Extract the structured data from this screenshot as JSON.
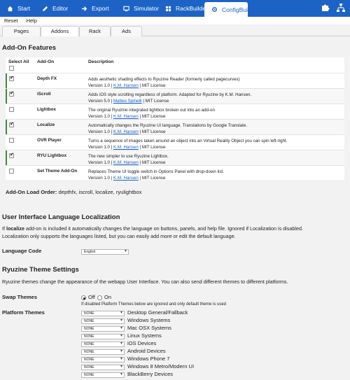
{
  "topbar": {
    "tabs": [
      {
        "label": "Start",
        "icon": "home-icon"
      },
      {
        "label": "Editor",
        "icon": "pencil-icon"
      },
      {
        "label": "Export",
        "icon": "export-icon"
      },
      {
        "label": "Simulator",
        "icon": "monitor-icon"
      },
      {
        "label": "RackBuilder",
        "icon": "grid-icon"
      },
      {
        "label": "ConfigBuilder",
        "icon": "gear-icon",
        "active": true
      }
    ],
    "right_icons": [
      "puzzle-icon",
      "sitemap-icon"
    ]
  },
  "subbar": {
    "reset": "Reset",
    "help": "Help"
  },
  "page_tabs": [
    {
      "label": "Pages"
    },
    {
      "label": "Addons",
      "active": true
    },
    {
      "label": "Rack"
    },
    {
      "label": "Ads"
    }
  ],
  "addons": {
    "heading": "Add-On Features",
    "col_select_all": "Select All",
    "col_addon": "Add-On",
    "col_description": "Description",
    "rows": [
      {
        "checked": true,
        "name": "Depth FX",
        "desc": "Adds aesthetic shading effects to Ryuzine Reader (formerly called pagecurves)",
        "version": "Version 1.0 |",
        "author": "K.M. Hansen",
        "license": "| MIT License"
      },
      {
        "checked": true,
        "name": "iScroll",
        "desc": "Adds iOS style scrolling regardless of platform. Adapted for Ryuzine by K.M. Hansen.",
        "version": "Version 5.0 |",
        "author": "Matteo Spinelli",
        "license": "| MIT License"
      },
      {
        "checked": false,
        "name": "Lightbox",
        "desc": "The original Ryuzine integrated lightbox broken out into an add-on",
        "version": "Version 1.0 |",
        "author": "K.M. Hansen",
        "license": "| MIT License"
      },
      {
        "checked": true,
        "name": "Localize",
        "desc": "Automatically changes the Ryuzine UI language. Translations by Google Translate.",
        "version": "Version 1.0 |",
        "author": "K.M. Hansen",
        "license": "| MIT License"
      },
      {
        "checked": false,
        "name": "OVR Player",
        "desc": "Turns a sequence of images taken around an object into an Virtual Reality Object you can spin left-right.",
        "version": "Version 1.0 |",
        "author": "K.M. Hansen",
        "license": "| MIT License"
      },
      {
        "checked": true,
        "name": "RYU Lightbox",
        "desc": "The new simpler to use Ryuzine Lightbox.",
        "version": "Version 1.0 |",
        "author": "K.M. Hansen",
        "license": "| MIT License"
      },
      {
        "checked": false,
        "name": "Set Theme Add-On",
        "desc": "Replaces Theme UI toggle switch in Options Panel with drop-down list.",
        "version": "Version 1.0 |",
        "author": "K.M. Hansen",
        "license": "| MIT License"
      }
    ],
    "load_order_label": "Add-On Load Order:",
    "load_order_value": "depthfx, iscroll, localize, ryulightbox"
  },
  "localization": {
    "heading": "User Interface Language Localization",
    "para_prefix": "If",
    "para_bold": "localize",
    "para_rest": "add-on is included it automatically changes the language on buttons, panels, and help file. Ignored if Localization is disabled.",
    "para_line2": "Localization only supports the languages listed, but you can easily add more or edit the default language.",
    "language_code_label": "Language Code",
    "language_value": "English"
  },
  "themes": {
    "heading": "Ryuzine Theme Settings",
    "para": "Ryuzine themes change the appearance of the webapp User Interface. You can also send different themes to different platforms.",
    "swap_label": "Swap Themes",
    "off_label": "Off",
    "on_label": "On",
    "swap_note": "If disabled Platform Themes below are ignored and only default theme is used",
    "platform_label": "Platform Themes",
    "platforms": [
      {
        "value": "NONE",
        "label": "Desktop General/Fallback"
      },
      {
        "value": "NONE",
        "label": "Windows Systems"
      },
      {
        "value": "NONE",
        "label": "Mac OSX Systems"
      },
      {
        "value": "NONE",
        "label": "Linux Systems"
      },
      {
        "value": "NONE",
        "label": "iOS Devices"
      },
      {
        "value": "NONE",
        "label": "Android Devices"
      },
      {
        "value": "NONE",
        "label": "Windows Phone 7"
      },
      {
        "value": "NONE",
        "label": "Windows 8 Metro/Modern UI"
      },
      {
        "value": "NONE",
        "label": "BlackBerry Devices"
      }
    ]
  },
  "colors": {
    "accent": "#1d63c6",
    "enabled_bar": "#3f8a3a",
    "link": "#1d63c6"
  }
}
